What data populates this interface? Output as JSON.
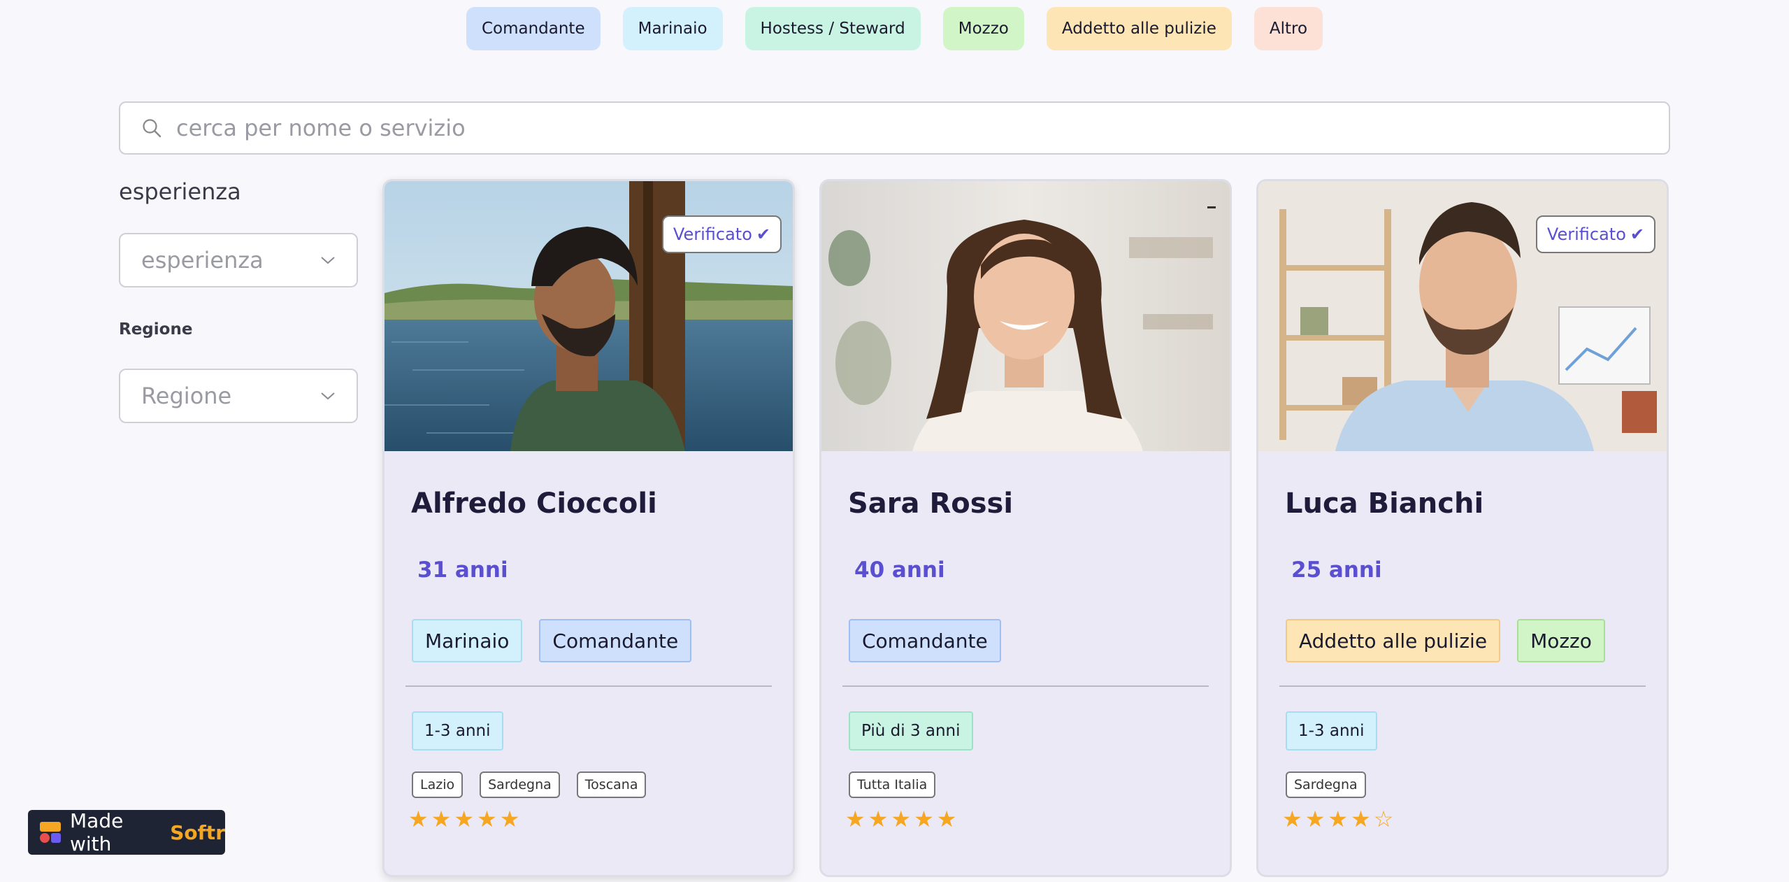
{
  "categories": [
    {
      "label": "Comandante",
      "color": "#cfe0fd"
    },
    {
      "label": "Marinaio",
      "color": "#d3f1fd"
    },
    {
      "label": "Hostess / Steward",
      "color": "#c9f4e3"
    },
    {
      "label": "Mozzo",
      "color": "#d2f5c7"
    },
    {
      "label": "Addetto alle pulizie",
      "color": "#fde5b5"
    },
    {
      "label": "Altro",
      "color": "#fde0d6"
    }
  ],
  "search": {
    "placeholder": "cerca per nome o servizio",
    "value": ""
  },
  "filters": {
    "experience": {
      "label": "esperienza",
      "placeholder": "esperienza"
    },
    "region": {
      "label": "Regione",
      "placeholder": "Regione"
    }
  },
  "cards": [
    {
      "badge": "Verificato",
      "name": "Alfredo Cioccoli",
      "age": "31 anni",
      "roles": [
        "Marinaio",
        "Comandante"
      ],
      "experience": "1-3 anni",
      "regions": [
        "Lazio",
        "Sardegna",
        "Toscana"
      ],
      "rating": 5
    },
    {
      "badge": "",
      "name": "Sara Rossi",
      "age": "40 anni",
      "roles": [
        "Comandante"
      ],
      "experience": "Più di 3 anni",
      "regions": [
        "Tutta Italia"
      ],
      "rating": 5
    },
    {
      "badge": "Verificato",
      "name": "Luca Bianchi",
      "age": "25 anni",
      "roles": [
        "Addetto alle pulizie",
        "Mozzo"
      ],
      "experience": "1-3 anni",
      "regions": [
        "Sardegna"
      ],
      "rating": 4
    }
  ],
  "rating_max": 5,
  "colors": {
    "accent": "#5a4fcf",
    "star": "#f5a623",
    "card_bg": "#ece9f7"
  },
  "softr": {
    "prefix": "Made with",
    "brand": "Softr"
  }
}
